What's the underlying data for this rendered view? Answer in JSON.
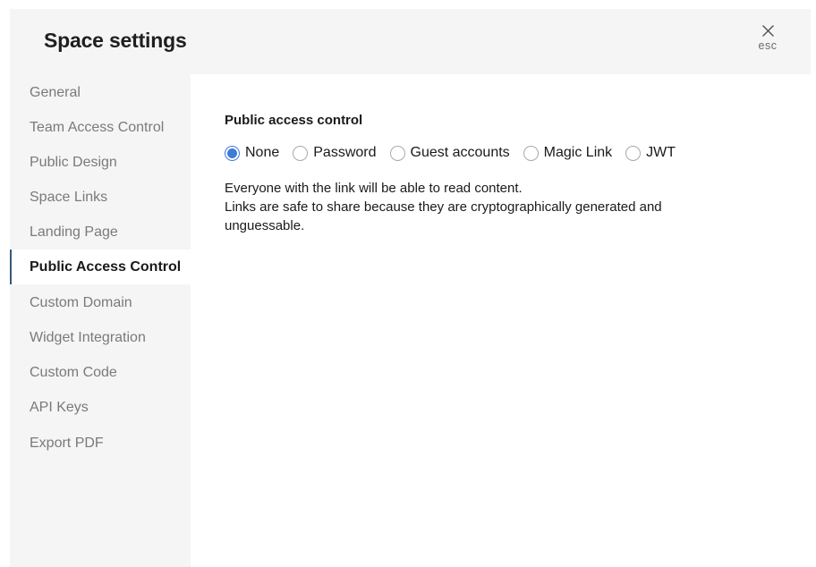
{
  "header": {
    "title": "Space settings",
    "close_label": "esc"
  },
  "sidebar": {
    "items": [
      {
        "label": "General"
      },
      {
        "label": "Team Access Control"
      },
      {
        "label": "Public Design"
      },
      {
        "label": "Space Links"
      },
      {
        "label": "Landing Page"
      },
      {
        "label": "Public Access Control",
        "active": true
      },
      {
        "label": "Custom Domain"
      },
      {
        "label": "Widget Integration"
      },
      {
        "label": "Custom Code"
      },
      {
        "label": "API Keys"
      },
      {
        "label": "Export PDF"
      }
    ]
  },
  "main": {
    "section_title": "Public access control",
    "options": [
      {
        "label": "None",
        "checked": true
      },
      {
        "label": "Password"
      },
      {
        "label": "Guest accounts"
      },
      {
        "label": "Magic Link"
      },
      {
        "label": "JWT"
      }
    ],
    "description_line1": "Everyone with the link will be able to read content.",
    "description_line2": "Links are safe to share because they are cryptographically generated and unguessable."
  },
  "colors": {
    "accent": "#3f7bd8",
    "active_border": "#35597e",
    "sidebar_bg": "#f5f5f5"
  }
}
